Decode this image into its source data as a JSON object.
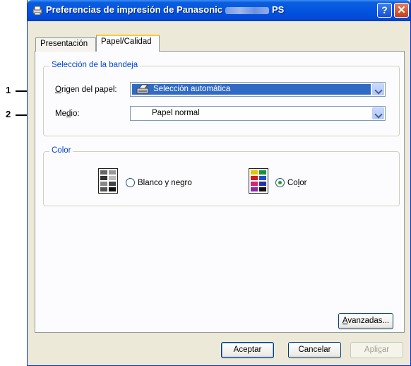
{
  "window": {
    "title_prefix": "Preferencias de impresión de Panasonic",
    "title_suffix": "PS",
    "help_label": "?",
    "close_label": "✕"
  },
  "tabs": [
    {
      "label": "Presentación",
      "active": false
    },
    {
      "label": "Papel/Calidad",
      "active": true
    }
  ],
  "tray_group": {
    "legend": "Selección de la bandeja",
    "origen_label": "Origen del papel:",
    "origen_value": "Selección automática",
    "medio_label": "Medio:",
    "medio_value": "Papel normal"
  },
  "color_group": {
    "legend": "Color",
    "bw_label": "Blanco y negro",
    "bw_checked": false,
    "color_label": "Color",
    "color_checked": true
  },
  "buttons": {
    "advanced": "Avanzadas...",
    "ok": "Aceptar",
    "cancel": "Cancelar",
    "apply": "Aplicar"
  },
  "callouts": [
    "1",
    "2"
  ],
  "colors": {
    "titlebar": "#0355e0",
    "legend_text": "#0046d5",
    "selection": "#316ac5"
  }
}
